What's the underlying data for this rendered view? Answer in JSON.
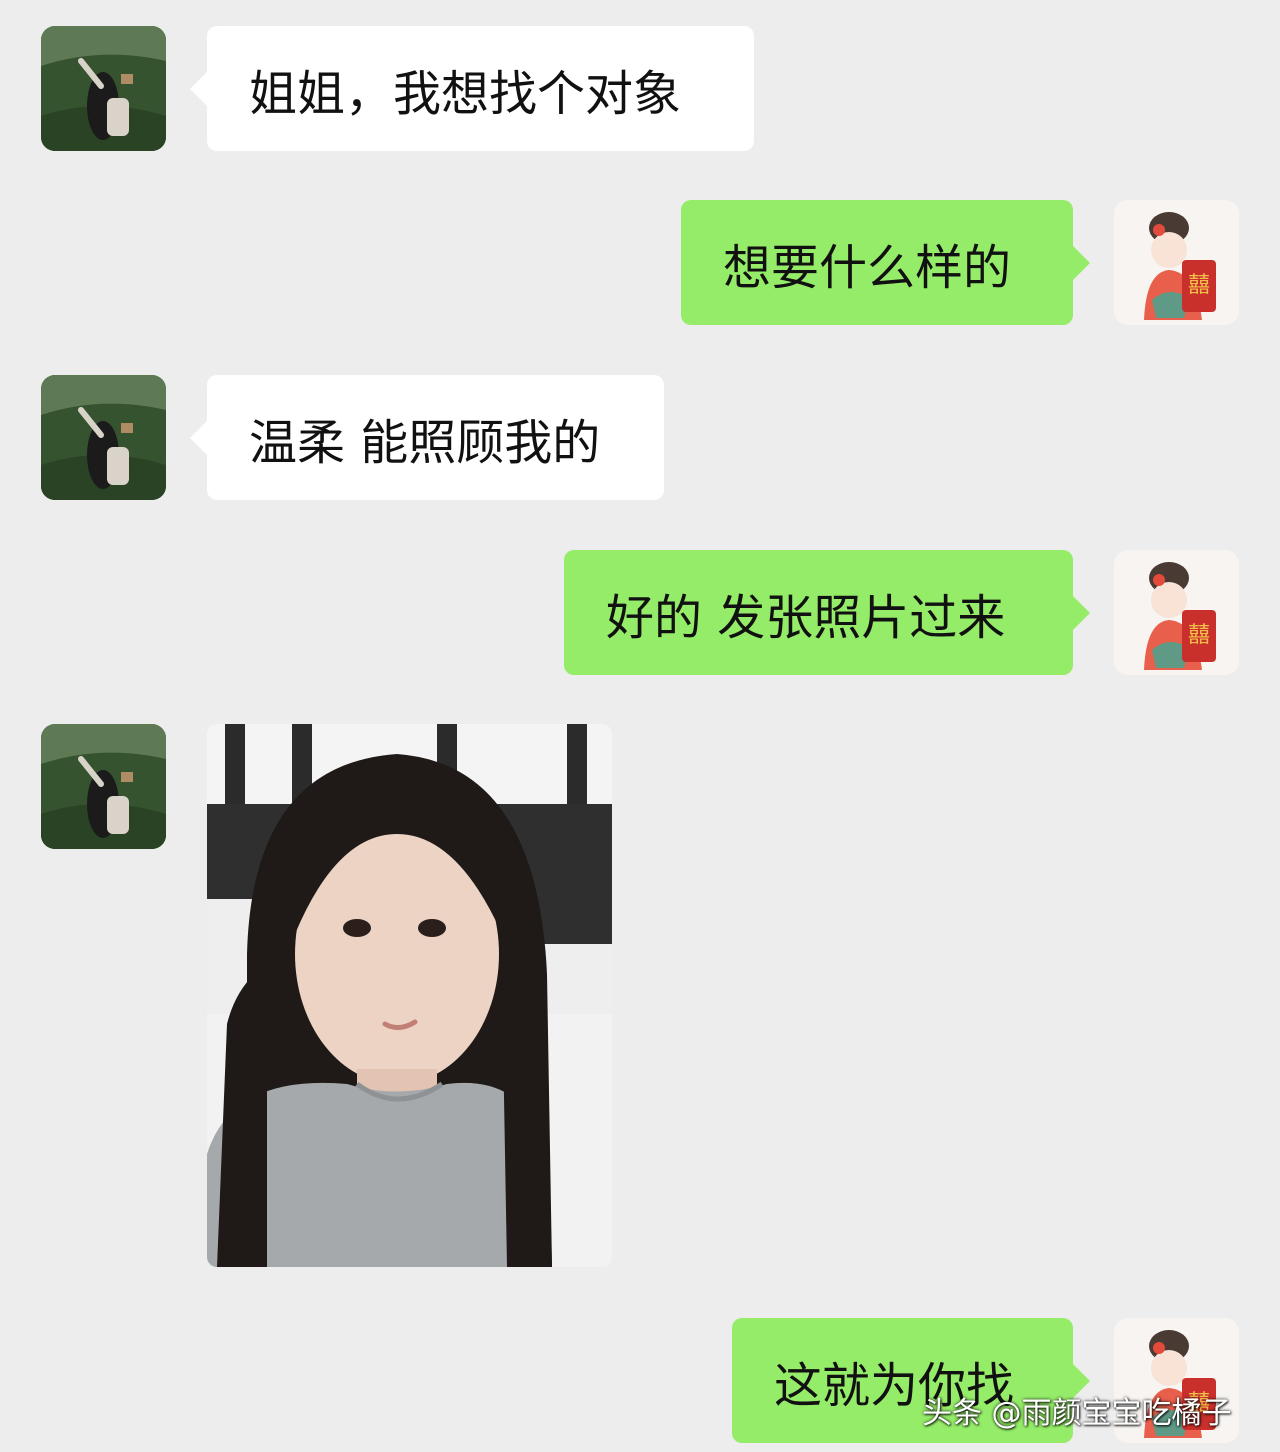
{
  "messages": [
    {
      "sender": "friend",
      "type": "text",
      "text": "姐姐，我想找个对象"
    },
    {
      "sender": "me",
      "type": "text",
      "text": "想要什么样的"
    },
    {
      "sender": "friend",
      "type": "text",
      "text": "温柔 能照顾我的"
    },
    {
      "sender": "me",
      "type": "text",
      "text": "好的 发张照片过来"
    },
    {
      "sender": "friend",
      "type": "image",
      "description": "selfie-photo"
    },
    {
      "sender": "me",
      "type": "text",
      "text": "这就为你找"
    }
  ],
  "avatars": {
    "friend": "grass-field-dancer-avatar",
    "me": "cartoon-bride-avatar"
  },
  "watermark": "头条 @雨颜宝宝吃橘子",
  "colors": {
    "background": "#ededed",
    "friend_bubble": "#ffffff",
    "me_bubble": "#95ec69"
  }
}
